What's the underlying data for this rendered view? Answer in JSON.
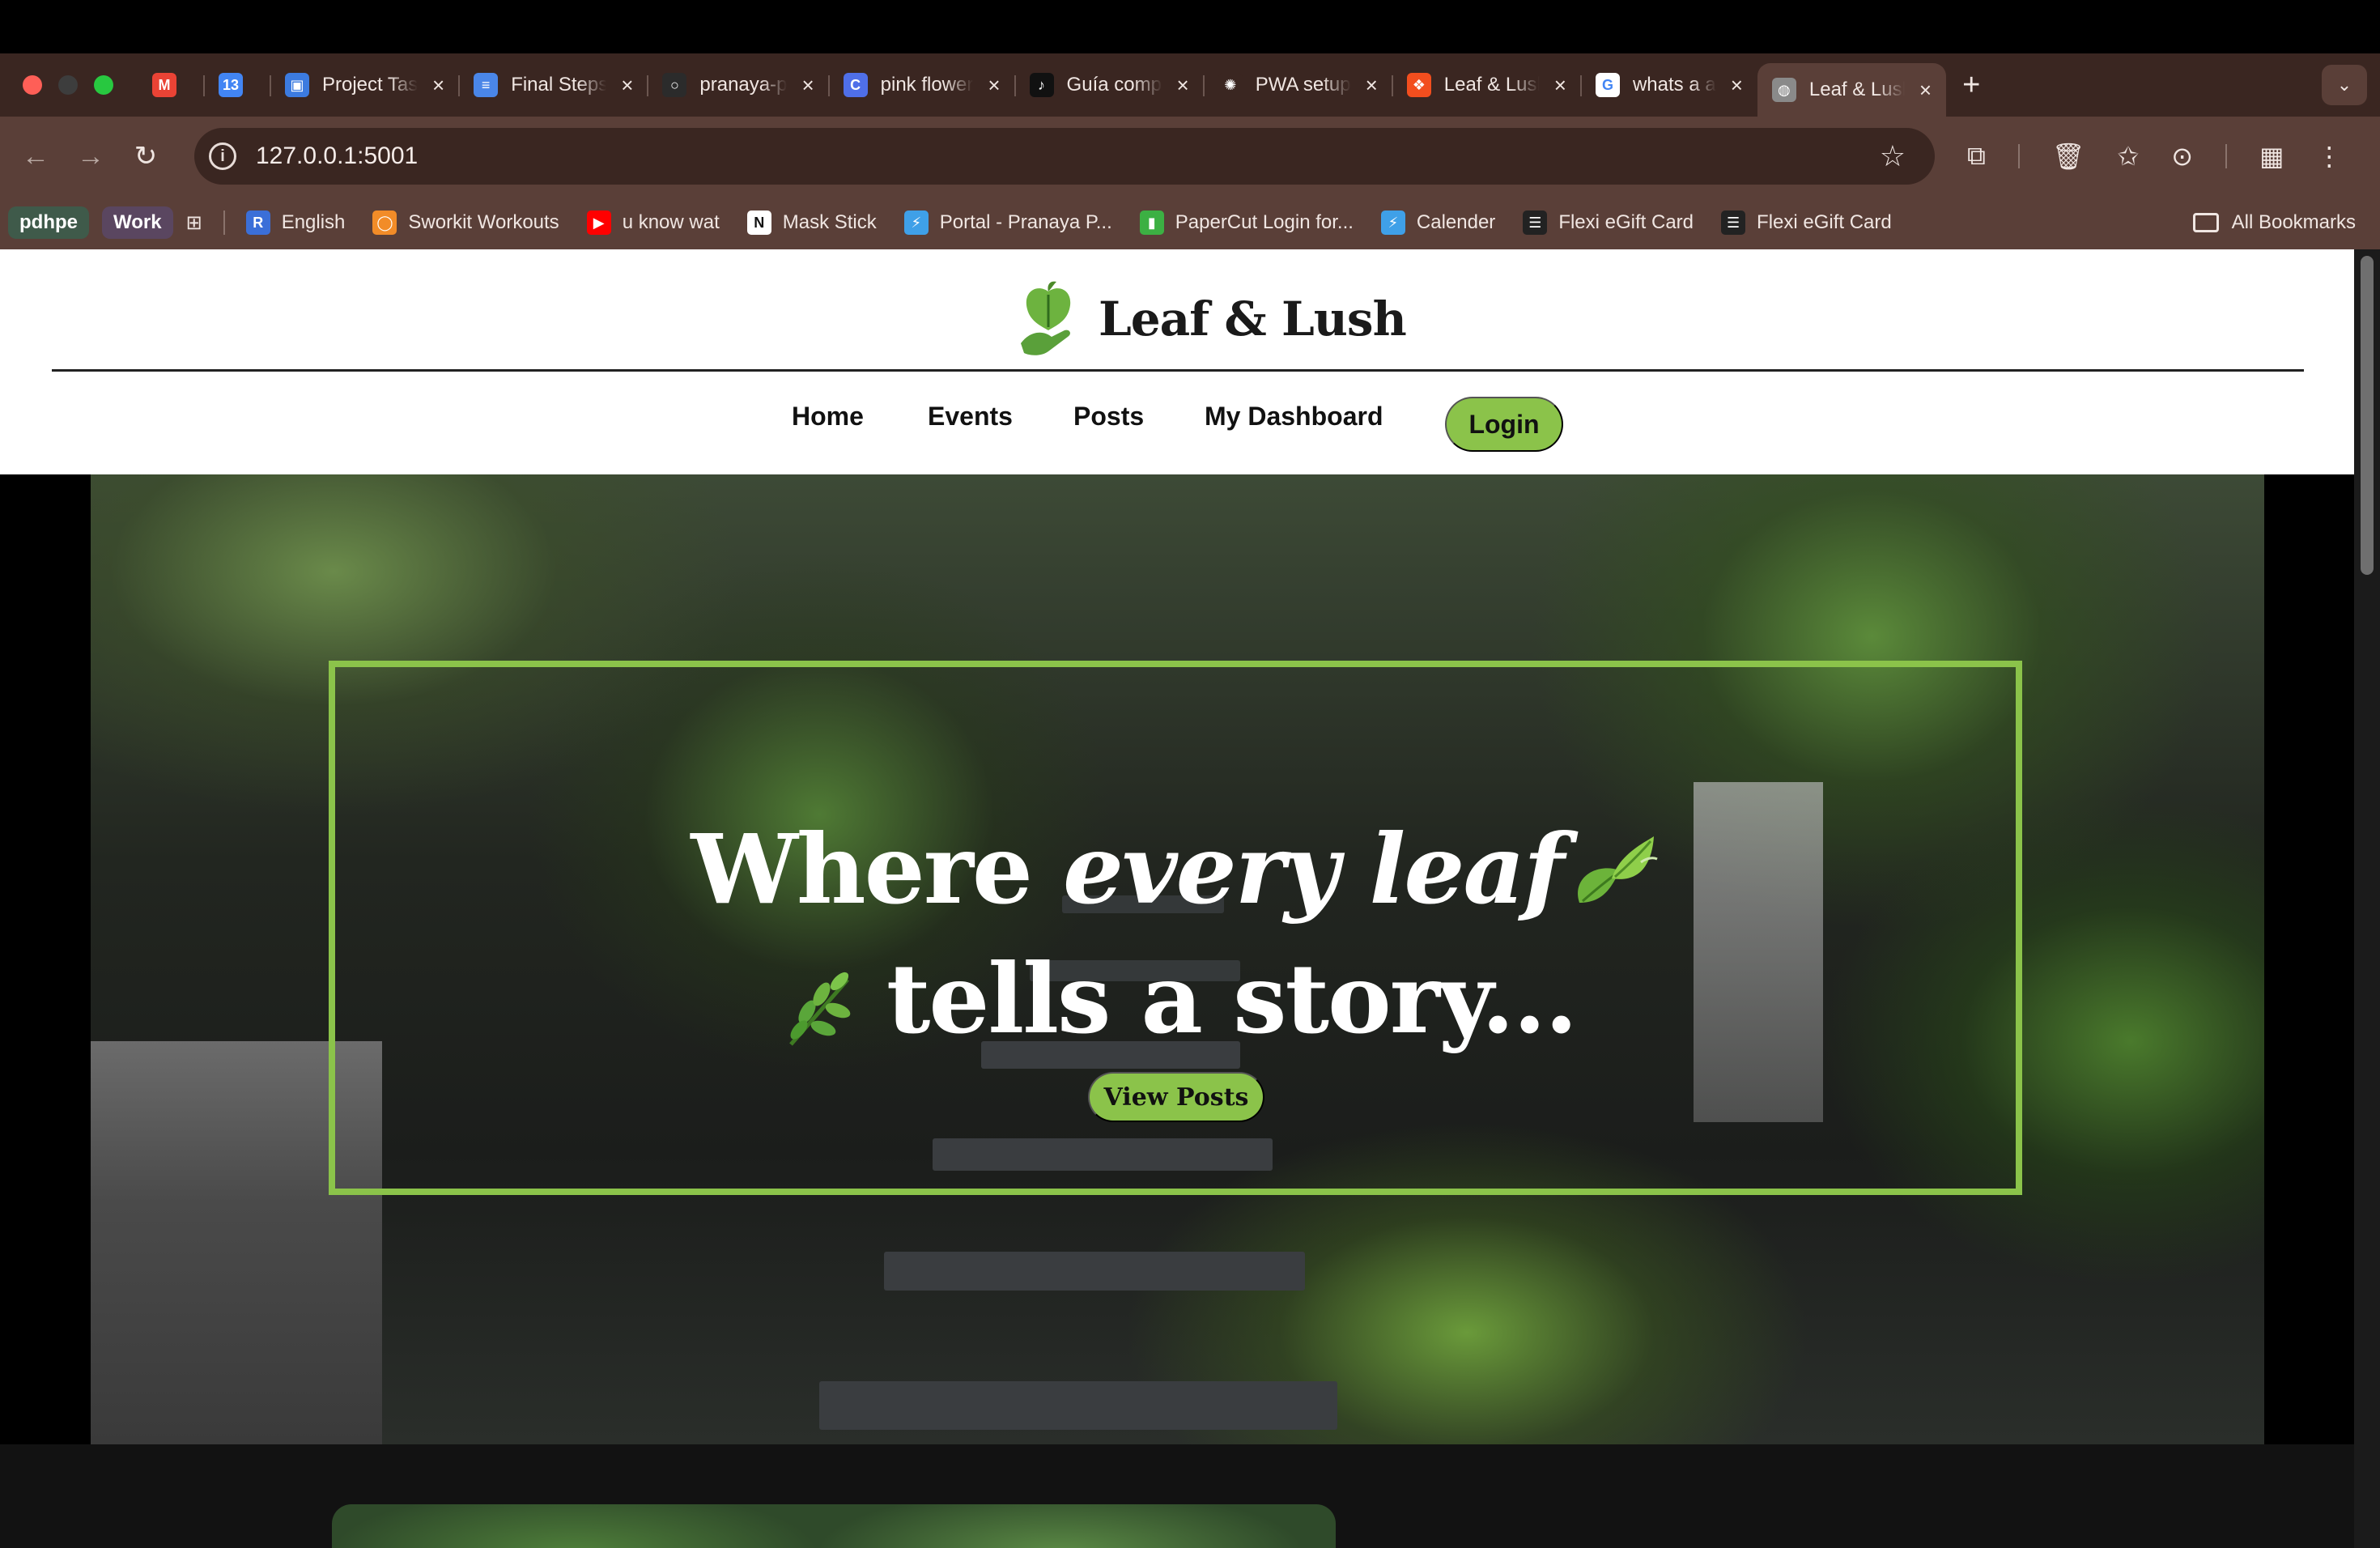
{
  "browser": {
    "tabs": [
      {
        "label": "",
        "icon": "gmail-icon",
        "favicon_color": "#ea4335",
        "favicon_text": "M"
      },
      {
        "label": "",
        "icon": "google-calendar-icon",
        "favicon_color": "#4285f4",
        "favicon_text": "13"
      },
      {
        "label": "Project Tasks",
        "icon": "google-classroom-icon",
        "favicon_color": "#3c7be0",
        "favicon_text": "▣"
      },
      {
        "label": "Final Steps",
        "icon": "google-docs-icon",
        "favicon_color": "#4a86e8",
        "favicon_text": "≡"
      },
      {
        "label": "pranaya-p",
        "icon": "github-icon",
        "favicon_color": "#2b2b2b",
        "favicon_text": "○"
      },
      {
        "label": "pink flower",
        "icon": "canva-icon",
        "favicon_color": "#4f6fe8",
        "favicon_text": "C"
      },
      {
        "label": "Guía completa",
        "icon": "tiktok-icon",
        "favicon_color": "#111111",
        "favicon_text": "♪"
      },
      {
        "label": "PWA setup",
        "icon": "openai-icon",
        "favicon_color": "#3a2621",
        "favicon_text": "✺"
      },
      {
        "label": "Leaf & Lush",
        "icon": "figma-icon",
        "favicon_color": "#f24e1e",
        "favicon_text": "❖"
      },
      {
        "label": "whats a a",
        "icon": "google-icon",
        "favicon_color": "#ffffff",
        "favicon_text": "G"
      },
      {
        "label": "Leaf & Lush",
        "icon": "globe-icon",
        "favicon_color": "#8a8a8a",
        "favicon_text": "◍"
      }
    ],
    "new_tab_label": "+",
    "url": "127.0.0.1:5001",
    "bookmarks": {
      "chips": [
        {
          "label": "pdhpe"
        },
        {
          "label": "Work"
        }
      ],
      "items": [
        {
          "label": "English",
          "icon": "r-app-icon",
          "color": "#3b6fd8",
          "text": "R"
        },
        {
          "label": "Sworkit Workouts",
          "icon": "sworkit-icon",
          "color": "#f28c28",
          "text": "◯"
        },
        {
          "label": "u know wat",
          "icon": "youtube-icon",
          "color": "#ff0000",
          "text": "▶"
        },
        {
          "label": "Mask Stick",
          "icon": "notion-icon",
          "color": "#ffffff",
          "text": "N"
        },
        {
          "label": "Portal - Pranaya P...",
          "icon": "school-portal-icon",
          "color": "#3fa0e8",
          "text": "⚡"
        },
        {
          "label": "PaperCut Login for...",
          "icon": "papercut-icon",
          "color": "#3cb043",
          "text": "▮"
        },
        {
          "label": "Calender",
          "icon": "school-portal-icon",
          "color": "#3fa0e8",
          "text": "⚡"
        },
        {
          "label": "Flexi eGift Card",
          "icon": "list-icon",
          "color": "#222222",
          "text": "☰"
        },
        {
          "label": "Flexi eGift Card",
          "icon": "list-icon",
          "color": "#222222",
          "text": "☰"
        }
      ],
      "all_bookmarks_label": "All Bookmarks"
    }
  },
  "site": {
    "brand_name": "Leaf & Lush",
    "nav": [
      {
        "label": "Home"
      },
      {
        "label": "Events"
      },
      {
        "label": "Posts"
      },
      {
        "label": "My Dashboard"
      }
    ],
    "login_label": "Login",
    "hero": {
      "line1_start": "Where ",
      "line1_em": "every leaf",
      "line2": "tells a story...",
      "button_label": "View Posts"
    }
  },
  "colors": {
    "accent_green": "#8bc34a",
    "browser_frame": "#3a2621",
    "browser_toolbar": "#5a3f38"
  }
}
